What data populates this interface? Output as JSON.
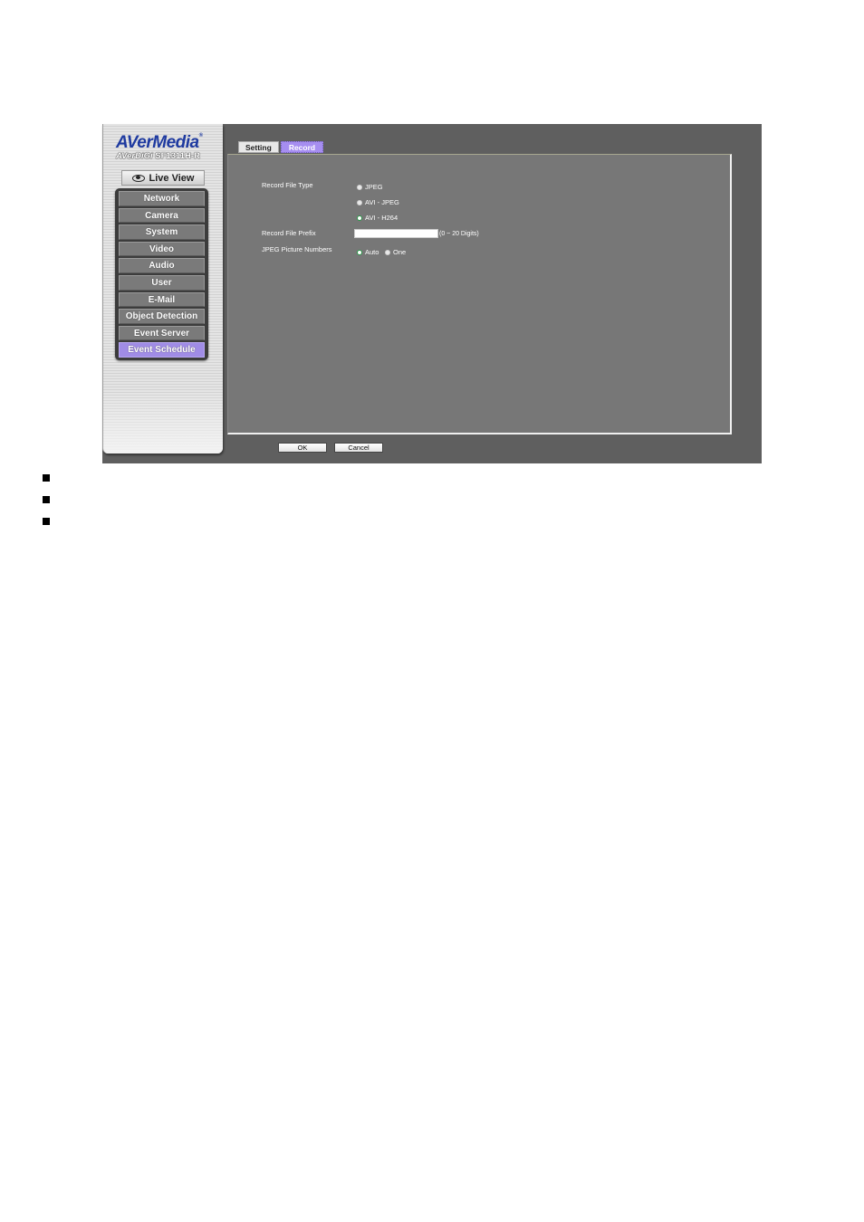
{
  "sidebar": {
    "brand": "AVerMedia",
    "brand_mark": "®",
    "model_prefix": "AVerDiGi",
    "model": "SF1311H-R",
    "live_view_label": "Live View",
    "live_view_icon": "eye-icon",
    "items": [
      {
        "label": "Network",
        "active": false
      },
      {
        "label": "Camera",
        "active": false
      },
      {
        "label": "System",
        "active": false
      },
      {
        "label": "Video",
        "active": false
      },
      {
        "label": "Audio",
        "active": false
      },
      {
        "label": "User",
        "active": false
      },
      {
        "label": "E-Mail",
        "active": false
      },
      {
        "label": "Object Detection",
        "active": false
      },
      {
        "label": "Event Server",
        "active": false
      },
      {
        "label": "Event Schedule",
        "active": true
      }
    ]
  },
  "tabs": [
    {
      "label": "Setting",
      "active": false
    },
    {
      "label": "Record",
      "active": true
    }
  ],
  "form": {
    "record_file_type": {
      "label": "Record File Type",
      "options": [
        "JPEG",
        "AVI - JPEG",
        "AVI - H264"
      ],
      "selected": "AVI - H264"
    },
    "record_file_prefix": {
      "label": "Record File Prefix",
      "value": "",
      "hint": "(0 ~ 20 Digits)"
    },
    "jpeg_picture_numbers": {
      "label": "JPEG Picture Numbers",
      "options": [
        "Auto",
        "One"
      ],
      "selected": "Auto"
    }
  },
  "buttons": {
    "ok": "OK",
    "cancel": "Cancel"
  },
  "colors": {
    "accent": "#a68ef0",
    "background": "#5f5f5f",
    "panel": "#777777",
    "brand": "#1e3aa0"
  },
  "bullets": [
    "",
    "",
    ""
  ]
}
